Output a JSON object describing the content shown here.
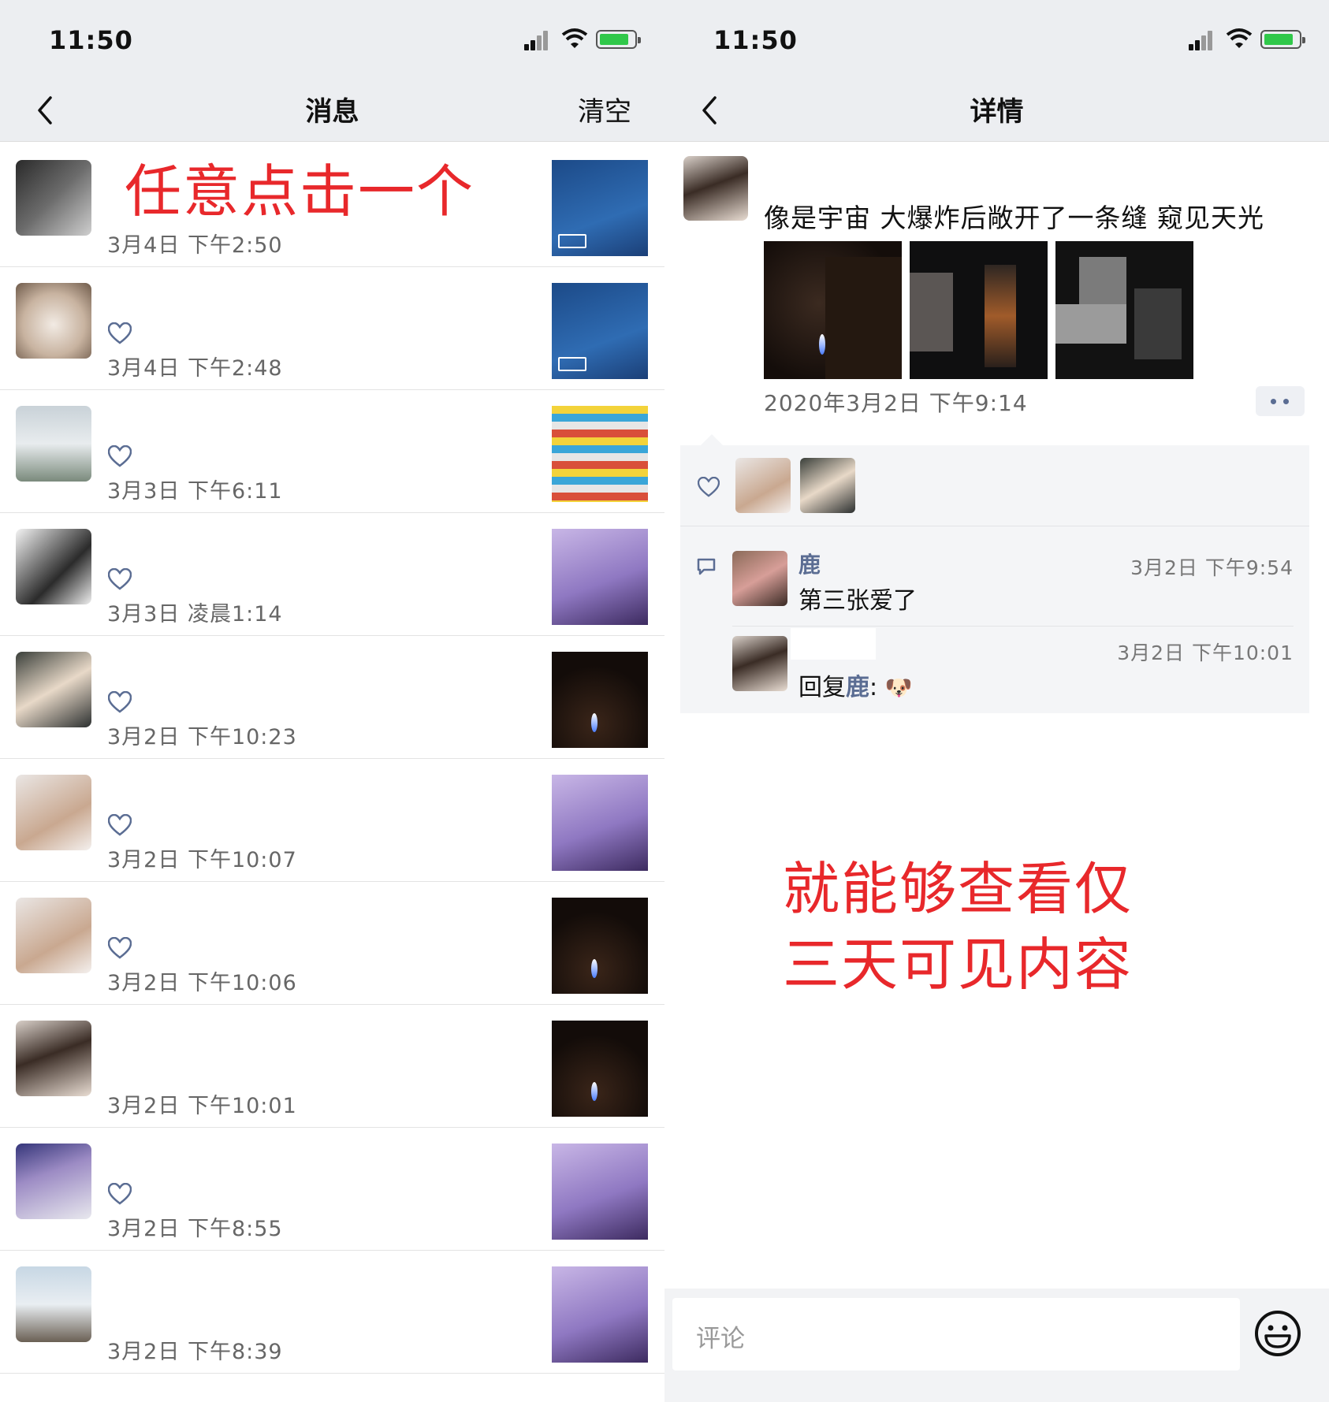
{
  "left_screen": {
    "status_time": "11:50",
    "nav": {
      "title": "消息",
      "right_action": "清空"
    },
    "annotation": "任意点击一个",
    "rows": [
      {
        "time": "3月4日 下午2:50",
        "liked": false,
        "thumb": "video",
        "av": "a1"
      },
      {
        "time": "3月4日 下午2:48",
        "liked": true,
        "thumb": "video",
        "av": "a2"
      },
      {
        "time": "3月3日 下午6:11",
        "liked": true,
        "thumb": "store",
        "av": "a3"
      },
      {
        "time": "3月3日 凌晨1:14",
        "liked": true,
        "thumb": "purple",
        "av": "a4"
      },
      {
        "time": "3月2日 下午10:23",
        "liked": true,
        "thumb": "candle",
        "av": "a5"
      },
      {
        "time": "3月2日 下午10:07",
        "liked": true,
        "thumb": "purple",
        "av": "a6"
      },
      {
        "time": "3月2日 下午10:06",
        "liked": true,
        "thumb": "candle",
        "av": "a6"
      },
      {
        "time": "3月2日 下午10:01",
        "liked": false,
        "thumb": "candle",
        "av": "a7"
      },
      {
        "time": "3月2日 下午8:55",
        "liked": true,
        "thumb": "purple",
        "av": "a8"
      },
      {
        "time": "3月2日 下午8:39",
        "liked": false,
        "thumb": "purple",
        "av": "a9"
      }
    ]
  },
  "right_screen": {
    "status_time": "11:50",
    "nav": {
      "title": "详情"
    },
    "post": {
      "text": "像是宇宙 大爆炸后敞开了一条缝 窥见天光",
      "time": "2020年3月2日 下午9:14"
    },
    "comments": [
      {
        "name": "鹿",
        "time": "3月2日 下午9:54",
        "text": "第三张爱了"
      },
      {
        "name": "",
        "time": "3月2日 下午10:01",
        "reply_prefix": "回复",
        "reply_to": "鹿",
        "reply_sep": ":",
        "emoji": "🐶"
      }
    ],
    "annotation_line1": "就能够查看仅",
    "annotation_line2": "三天可见内容",
    "input_placeholder": "评论"
  },
  "colors": {
    "accent_link": "#5b6d93",
    "annotation_red": "#e8282b",
    "nav_bg": "#eceef1"
  }
}
